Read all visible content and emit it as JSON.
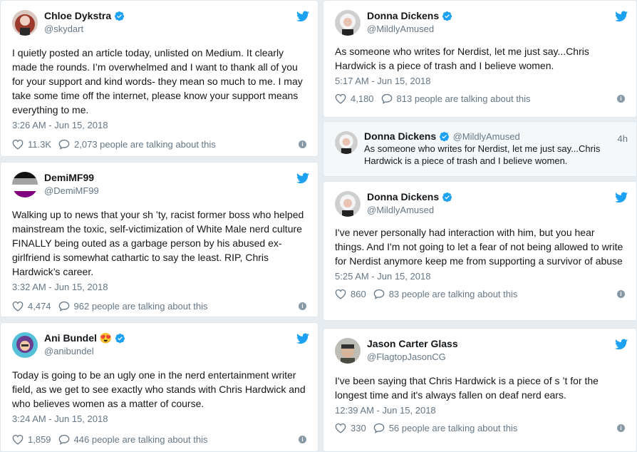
{
  "tweets": {
    "chloe": {
      "name": "Chloe Dykstra",
      "handle": "@skydart",
      "text": "I quietly posted an article today, unlisted on Medium. It clearly made the rounds. I’m overwhelmed and I want to thank all of you for your support and kind words- they mean so much to me. I may take some time off the internet,  please know your support means everything to me.",
      "time": "3:26 AM - Jun 15, 2018",
      "likes": "11.3K",
      "talking": "2,073 people are talking about this"
    },
    "demi": {
      "name": "DemiMF99",
      "handle": "@DemiMF99",
      "text": "Walking up to news that your sh  ’ty, racist former boss who helped mainstream the toxic, self-victimization of White Male nerd culture FINALLY being outed as a garbage person by his abused ex-girlfriend is somewhat cathartic to say the least. RIP, Chris Hardwick’s career.",
      "time": "3:32 AM - Jun 15, 2018",
      "likes": "4,474",
      "talking": "962 people are talking about this"
    },
    "ani": {
      "name": "Ani Bundel",
      "handle": "@anibundel",
      "emoji": "😍",
      "text": "Today is going to be an ugly one in the nerd entertainment writer field, as we get to see exactly who stands with Chris Hardwick and who believes women as a matter of course.",
      "time": "3:24 AM - Jun 15, 2018",
      "likes": "1,859",
      "talking": "446 people are talking about this"
    },
    "donna1": {
      "name": "Donna Dickens",
      "handle": "@MildlyAmused",
      "text": "As someone who writes for Nerdist, let me just say...Chris Hardwick is a piece of trash and I believe women.",
      "time": "5:17 AM - Jun 15, 2018",
      "likes": "4,180",
      "talking": "813 people are talking about this"
    },
    "donna2": {
      "name": "Donna Dickens",
      "handle": "@MildlyAmused",
      "ago": "4h",
      "text": "As someone who writes for Nerdist, let me just say...Chris Hardwick is a piece of trash and I believe women."
    },
    "donna3": {
      "name": "Donna Dickens",
      "handle": "@MildlyAmused",
      "text": "I've never personally had interaction with him, but you hear things. And I'm not going to let a fear of not being allowed to write for Nerdist anymore keep me from supporting a survivor of abuse",
      "time": "5:25 AM - Jun 15, 2018",
      "likes": "860",
      "talking": "83 people are talking about this"
    },
    "jason": {
      "name": "Jason Carter Glass",
      "handle": "@FlagtopJasonCG",
      "text": "I've been saying that Chris Hardwick is a piece of s  ’t for the longest time and it's always fallen on deaf nerd ears.",
      "time": "12:39 AM - Jun 15, 2018",
      "likes": "330",
      "talking": "56 people are talking about this"
    }
  },
  "colors": {
    "twitter_blue": "#1da1f2",
    "muted": "#657786"
  }
}
